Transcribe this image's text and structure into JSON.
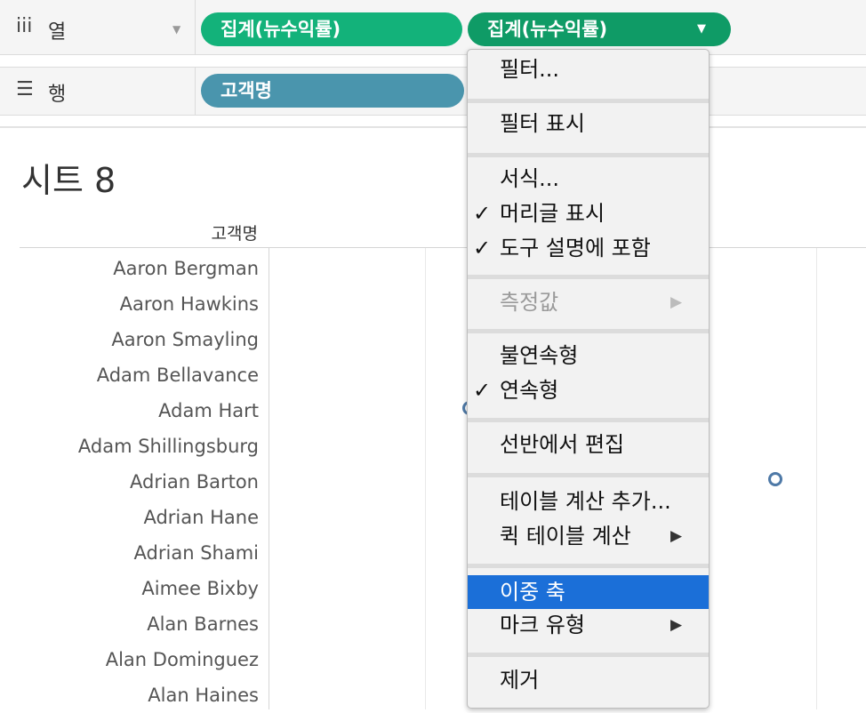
{
  "shelves": {
    "columns": {
      "icon": "iii",
      "label": "열",
      "pills": [
        "집계(뉴수익률)",
        "집계(뉴수익률)"
      ]
    },
    "rows": {
      "icon": "☰",
      "label": "행",
      "pills": [
        "고객명"
      ]
    }
  },
  "sheet": {
    "title": "시트 8",
    "row_header": "고객명",
    "customers": [
      "Aaron Bergman",
      "Aaron Hawkins",
      "Aaron Smayling",
      "Adam Bellavance",
      "Adam Hart",
      "Adam Shillingsburg",
      "Adrian Barton",
      "Adrian Hane",
      "Adrian Shami",
      "Aimee Bixby",
      "Alan Barnes",
      "Alan Dominguez",
      "Alan Haines"
    ]
  },
  "context_menu": {
    "items": [
      {
        "label": "필터...",
        "checked": false,
        "submenu": false,
        "disabled": false,
        "highlighted": false
      },
      {
        "label": "필터 표시",
        "checked": false,
        "submenu": false,
        "disabled": false,
        "highlighted": false
      },
      {
        "label": "서식...",
        "checked": false,
        "submenu": false,
        "disabled": false,
        "highlighted": false
      },
      {
        "label": "머리글 표시",
        "checked": true,
        "submenu": false,
        "disabled": false,
        "highlighted": false
      },
      {
        "label": "도구 설명에 포함",
        "checked": true,
        "submenu": false,
        "disabled": false,
        "highlighted": false
      },
      {
        "label": "측정값",
        "checked": false,
        "submenu": true,
        "disabled": true,
        "highlighted": false
      },
      {
        "label": "불연속형",
        "checked": false,
        "submenu": false,
        "disabled": false,
        "highlighted": false
      },
      {
        "label": "연속형",
        "checked": true,
        "submenu": false,
        "disabled": false,
        "highlighted": false
      },
      {
        "label": "선반에서 편집",
        "checked": false,
        "submenu": false,
        "disabled": false,
        "highlighted": false
      },
      {
        "label": "테이블 계산 추가...",
        "checked": false,
        "submenu": false,
        "disabled": false,
        "highlighted": false
      },
      {
        "label": "퀵 테이블 계산",
        "checked": false,
        "submenu": true,
        "disabled": false,
        "highlighted": false
      },
      {
        "label": "이중 축",
        "checked": false,
        "submenu": false,
        "disabled": false,
        "highlighted": true
      },
      {
        "label": "마크 유형",
        "checked": false,
        "submenu": true,
        "disabled": false,
        "highlighted": false
      },
      {
        "label": "제거",
        "checked": false,
        "submenu": false,
        "disabled": false,
        "highlighted": false
      }
    ],
    "check_glyph": "✓",
    "submenu_glyph": "▶"
  },
  "colors": {
    "measure_pill": "#13b27a",
    "dimension_pill": "#4a95ad",
    "highlight": "#1b6fd8",
    "mark": "#4e79a7"
  }
}
